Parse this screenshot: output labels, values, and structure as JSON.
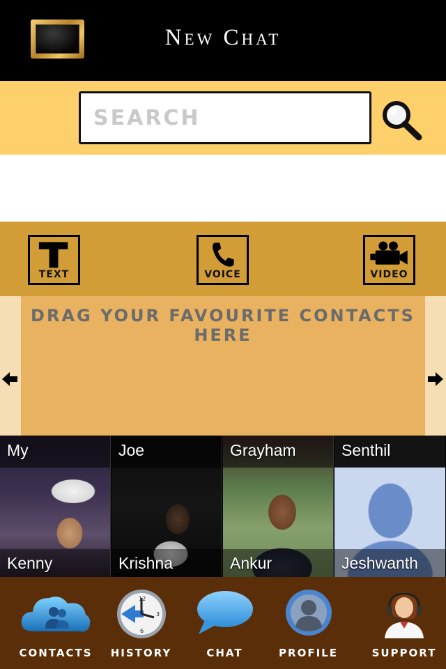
{
  "header": {
    "title": "New Chat",
    "menu_icon": "framed-menu-icon"
  },
  "search": {
    "placeholder": "SEARCH",
    "value": "",
    "icon": "search-icon"
  },
  "modes": [
    {
      "label": "TEXT",
      "icon": "text-icon"
    },
    {
      "label": "VOICE",
      "icon": "phone-icon"
    },
    {
      "label": "VIDEO",
      "icon": "video-camera-icon"
    }
  ],
  "favourites": {
    "hint": "DRAG YOUR FAVOURITE CONTACTS HERE"
  },
  "contacts": [
    {
      "first": "My",
      "last": "Kenny"
    },
    {
      "first": "Joe",
      "last": "Krishna"
    },
    {
      "first": "Grayham",
      "last": "Ankur"
    },
    {
      "first": "Senthil",
      "last": "Jeshwanth"
    }
  ],
  "tabs": [
    {
      "label": "CONTACTS",
      "icon": "contacts-cloud-icon"
    },
    {
      "label": "HISTORY",
      "icon": "clock-icon"
    },
    {
      "label": "CHAT",
      "icon": "chat-bubble-icon"
    },
    {
      "label": "PROFILE",
      "icon": "profile-icon"
    },
    {
      "label": "SUPPORT",
      "icon": "support-agent-icon"
    }
  ],
  "colors": {
    "accent": "#fdd06b",
    "mode_bar": "#d29d37",
    "fav_drop": "#e8b260",
    "tab_bar": "#5a2e08"
  }
}
